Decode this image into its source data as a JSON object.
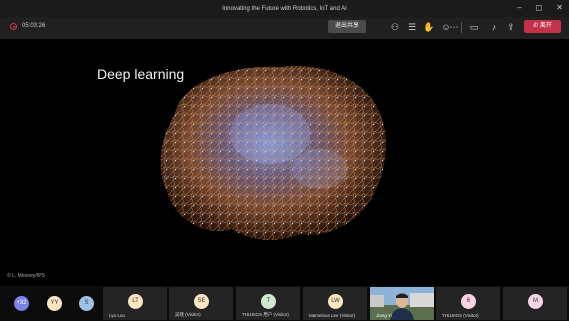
{
  "window": {
    "title": "Innovating the Future with Robotics, IoT and AI"
  },
  "toolbar": {
    "timer": "05:03:26",
    "share_label": "退出共享",
    "leave_label": "离开"
  },
  "slide": {
    "title": "Deep learning",
    "credit": "© L. Mooney/IPS"
  },
  "participants": [
    {
      "initials": "+32",
      "color": "#7b83eb",
      "name": ""
    },
    {
      "initials": "YY",
      "color": "#fde7c3",
      "name": ""
    },
    {
      "initials": "S",
      "color": "#9fc3e6",
      "name": ""
    },
    {
      "initials": "LT",
      "color": "#fde7c3",
      "name": "Lyu Luo"
    },
    {
      "initials": "SE",
      "color": "#fde7c3",
      "name": "吴晓 (Visitor)"
    },
    {
      "initials": "T",
      "color": "#cfe8cf",
      "name": "THUSIGS 用户 (Visitor)"
    },
    {
      "initials": "LW",
      "color": "#fde7c3",
      "name": "Marvelous Lee (Visitor)"
    },
    {
      "initials": "",
      "color": "",
      "name": "Jiang Yi"
    },
    {
      "initials": "6",
      "color": "#f9d3e3",
      "name": "THUSIGS (Visitor)"
    },
    {
      "initials": "M",
      "color": "#f4d6e6",
      "name": ""
    }
  ]
}
